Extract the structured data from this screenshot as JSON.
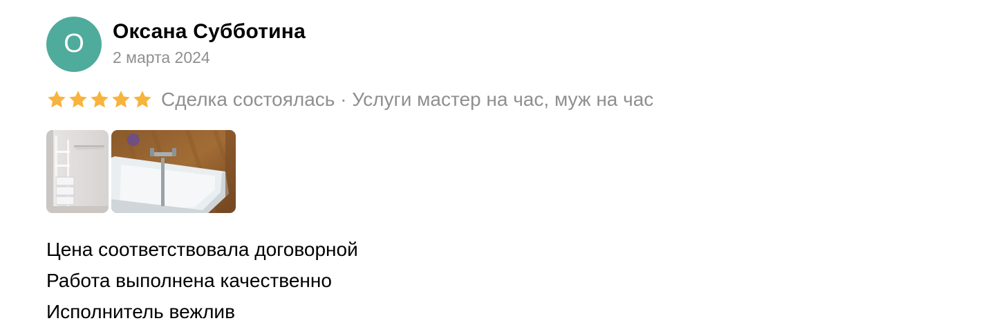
{
  "review": {
    "author": {
      "initial": "О",
      "name": "Оксана Субботина",
      "avatar_color": "#4fab9c"
    },
    "date": "2 марта 2024",
    "rating": {
      "value": 5,
      "max": 5,
      "star_color": "#f7b33c"
    },
    "meta": "Сделка состоялась · Услуги мастер на час, муж на час",
    "photos": [
      {
        "icon": "photo-shelving-thumbnail"
      },
      {
        "icon": "photo-bathtub-faucet-thumbnail"
      }
    ],
    "lines": [
      "Цена соответствовала договорной",
      "Работа выполнена качественно",
      "Исполнитель вежлив"
    ]
  }
}
